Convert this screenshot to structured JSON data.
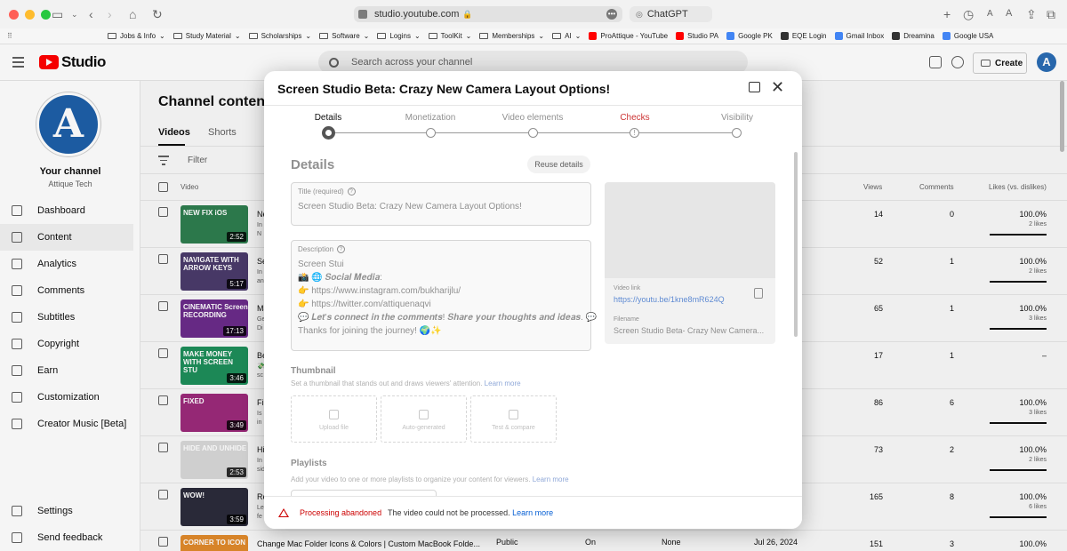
{
  "browser": {
    "url": "studio.youtube.com",
    "second_tab": "ChatGPT",
    "bookmarks": [
      {
        "label": "Jobs & Info",
        "type": "folder"
      },
      {
        "label": "Study Material",
        "type": "folder"
      },
      {
        "label": "Scholarships",
        "type": "folder"
      },
      {
        "label": "Software",
        "type": "folder"
      },
      {
        "label": "Logins",
        "type": "folder"
      },
      {
        "label": "ToolKit",
        "type": "folder"
      },
      {
        "label": "Memberships",
        "type": "folder"
      },
      {
        "label": "AI",
        "type": "folder"
      },
      {
        "label": "ProAttique - YouTube",
        "type": "youtube"
      },
      {
        "label": "Studio PA",
        "type": "youtube"
      },
      {
        "label": "Google PK",
        "type": "google"
      },
      {
        "label": "EQE Login",
        "type": "site"
      },
      {
        "label": "Gmail Inbox",
        "type": "google"
      },
      {
        "label": "Dreamina",
        "type": "site"
      },
      {
        "label": "Google USA",
        "type": "google"
      }
    ]
  },
  "header": {
    "logo_text": "Studio",
    "search_placeholder": "Search across your channel",
    "create_label": "Create",
    "avatar_letter": "A"
  },
  "sidebar": {
    "channel_name": "Your channel",
    "channel_handle": "Attique Tech",
    "avatar_letter": "A",
    "items": [
      {
        "label": "Dashboard",
        "icon": "dashboard-icon"
      },
      {
        "label": "Content",
        "icon": "content-icon",
        "active": true
      },
      {
        "label": "Analytics",
        "icon": "analytics-icon"
      },
      {
        "label": "Comments",
        "icon": "comments-icon"
      },
      {
        "label": "Subtitles",
        "icon": "subtitles-icon"
      },
      {
        "label": "Copyright",
        "icon": "copyright-icon"
      },
      {
        "label": "Earn",
        "icon": "earn-icon"
      },
      {
        "label": "Customization",
        "icon": "customization-icon"
      },
      {
        "label": "Creator Music [Beta]",
        "icon": "music-icon"
      }
    ],
    "bottom_items": [
      {
        "label": "Settings",
        "icon": "gear-icon"
      },
      {
        "label": "Send feedback",
        "icon": "feedback-icon"
      }
    ]
  },
  "content": {
    "title": "Channel content",
    "tabs": [
      "Videos",
      "Shorts"
    ],
    "filter_placeholder": "Filter",
    "columns": {
      "video": "Video",
      "views": "Views",
      "comments": "Comments",
      "likes": "Likes (vs. dislikes)"
    },
    "rows": [
      {
        "thumb_text": "NEW FIX iOS",
        "thumb_color": "#2e7d4f",
        "duration": "2:52",
        "title": "Ne",
        "desc": [
          "In",
          "N"
        ],
        "views": "14",
        "comments": "0",
        "likes": "100.0%",
        "likes_sub": "2 likes"
      },
      {
        "thumb_text": "NAVIGATE WITH ARROW KEYS",
        "thumb_color": "#4a3b6b",
        "duration": "5:17",
        "title": "Se",
        "desc": [
          "In",
          "an"
        ],
        "views": "52",
        "comments": "1",
        "likes": "100.0%",
        "likes_sub": "2 likes"
      },
      {
        "thumb_text": "CINEMATIC Screen RECORDING",
        "thumb_color": "#6b2b8a",
        "duration": "17:13",
        "title": "Ma",
        "desc": [
          "Ge",
          "Di"
        ],
        "views": "65",
        "comments": "1",
        "likes": "100.0%",
        "likes_sub": "3 likes"
      },
      {
        "thumb_text": "MAKE MONEY WITH SCREEN STU",
        "thumb_color": "#1e8e5a",
        "duration": "3:46",
        "title": "Be",
        "desc": [
          "💸",
          "sc"
        ],
        "views": "17",
        "comments": "1",
        "likes": "–",
        "likes_sub": ""
      },
      {
        "thumb_text": "FIXED",
        "thumb_color": "#9c2a7a",
        "duration": "3:49",
        "title": "Fi",
        "desc": [
          "Is",
          "in"
        ],
        "views": "86",
        "comments": "6",
        "likes": "100.0%",
        "likes_sub": "3 likes"
      },
      {
        "thumb_text": "HIDE AND UNHIDE",
        "thumb_color": "#d8d8d8",
        "duration": "2:53",
        "title": "Hi",
        "desc": [
          "In",
          "sid"
        ],
        "views": "73",
        "comments": "2",
        "likes": "100.0%",
        "likes_sub": "2 likes"
      },
      {
        "thumb_text": "WOW!",
        "thumb_color": "#2b2b3b",
        "duration": "3:59",
        "title": "Re",
        "desc": [
          "Le",
          "fe"
        ],
        "views": "165",
        "comments": "8",
        "likes": "100.0%",
        "likes_sub": "6 likes"
      },
      {
        "thumb_text": "CORNER TO ICON",
        "thumb_color": "#e08a2b",
        "duration": "",
        "title": "Change Mac Folder Icons & Colors | Custom MacBook Folde...",
        "desc": [],
        "visibility": "Public",
        "monetization": "On",
        "restrictions": "None",
        "date": "Jul 26, 2024",
        "views": "151",
        "comments": "3",
        "likes": "100.0%",
        "likes_sub": ""
      }
    ]
  },
  "modal": {
    "title": "Screen Studio Beta: Crazy New Camera Layout Options!",
    "steps": [
      {
        "label": "Details",
        "state": "active"
      },
      {
        "label": "Monetization",
        "state": "pending"
      },
      {
        "label": "Video elements",
        "state": "pending"
      },
      {
        "label": "Checks",
        "state": "warning"
      },
      {
        "label": "Visibility",
        "state": "pending"
      }
    ],
    "section_title": "Details",
    "reuse_label": "Reuse details",
    "title_field": {
      "label": "Title (required)",
      "value": "Screen Studio Beta: Crazy New Camera Layout Options!"
    },
    "description_field": {
      "label": "Description",
      "lines": [
        "Screen Stui",
        "📸 🌐 𝑺𝒐𝒄𝒊𝒂𝒍 𝑴𝒆𝒅𝒊𝒂:",
        "👉 https://www.instagram.com/bukharijlu/",
        "👉 https://twitter.com/attiquenaqvi",
        "💬 𝑳𝒆𝒕'𝒔 𝒄𝒐𝒏𝒏𝒆𝒄𝒕 𝒊𝒏 𝒕𝒉𝒆 𝒄𝒐𝒎𝒎𝒆𝒏𝒕𝒔! 𝑺𝒉𝒂𝒓𝒆 𝒚𝒐𝒖𝒓 𝒕𝒉𝒐𝒖𝒈𝒉𝒕𝒔 𝒂𝒏𝒅 𝒊𝒅𝒆𝒂𝒔. 💬",
        "Thanks for joining the journey! 🌍✨"
      ]
    },
    "video_link_label": "Video link",
    "video_link": "https://youtu.be/1kne8mR624Q",
    "filename_label": "Filename",
    "filename": "Screen Studio Beta- Crazy New Camera...",
    "thumbnail_title": "Thumbnail",
    "thumbnail_text": "Set a thumbnail that stands out and draws viewers' attention.",
    "learn_more": "Learn more",
    "thumbnail_options": [
      "Upload file",
      "Auto-generated",
      "Test & compare"
    ],
    "playlists_title": "Playlists",
    "playlists_text": "Add your video to one or more playlists to organize your content for viewers.",
    "footer_status": "Processing abandoned",
    "footer_message": "The video could not be processed."
  }
}
